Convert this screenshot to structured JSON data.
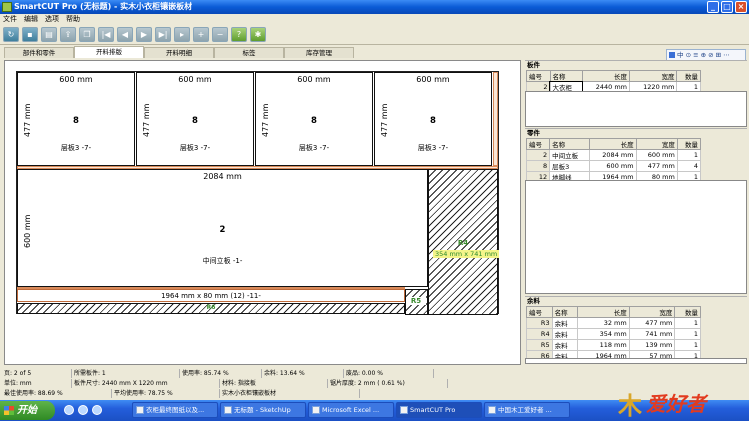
{
  "window": {
    "title": "SmartCUT Pro (无标题) - 实木小衣柜镶嵌板材",
    "controls": [
      "_",
      "□",
      "×"
    ]
  },
  "menu": [
    "文件",
    "编辑",
    "选项",
    "帮助"
  ],
  "toolbar": {
    "buttons": [
      "refresh-icon",
      "save-icon",
      "print-icon",
      "export-icon",
      "copy-icon",
      "first-icon",
      "prev-icon",
      "play-icon",
      "next-icon",
      "last-icon",
      "add-icon",
      "remove-icon",
      "help-icon",
      "settings-icon"
    ]
  },
  "tabs": [
    "部件和零件",
    "开料排版",
    "开料明细",
    "标签",
    "库存管理"
  ],
  "active_tab": "开料排版",
  "right_toolbar": {
    "label": "中 ⊙ ≡ ⊕ ⊘ ⊞ ⋯"
  },
  "layout": {
    "parts": [
      {
        "width": "600 mm",
        "height": "477 mm",
        "num": "8",
        "name": "层板3  -7-"
      },
      {
        "width": "600 mm",
        "height": "477 mm",
        "num": "8",
        "name": "层板3  -7-"
      },
      {
        "width": "600 mm",
        "height": "477 mm",
        "num": "8",
        "name": "层板3  -7-"
      },
      {
        "width": "600 mm",
        "height": "477 mm",
        "num": "8",
        "name": "层板3  -7-"
      }
    ],
    "big": {
      "width": "2084 mm",
      "height": "600 mm",
      "num": "2",
      "name": "中间立板  -1-"
    },
    "strip": {
      "label": "1964 mm x 80 mm (12)  -11-"
    },
    "r4": {
      "label": "R4",
      "dim": "354 mm x 741 mm"
    },
    "r5": {
      "label": "R5"
    },
    "r6": {
      "label": "R6"
    }
  },
  "panels": {
    "boards": {
      "caption": "板件",
      "headers": [
        "编号",
        "名称",
        "长度",
        "宽度",
        "数量"
      ],
      "rows": [
        [
          "2",
          "大衣柜",
          "2440 mm",
          "1220 mm",
          "1"
        ]
      ]
    },
    "parts": {
      "caption": "零件",
      "headers": [
        "编号",
        "名称",
        "长度",
        "宽度",
        "数量"
      ],
      "rows": [
        [
          "2",
          "中间立板",
          "2084 mm",
          "600 mm",
          "1"
        ],
        [
          "8",
          "层板3",
          "600 mm",
          "477 mm",
          "4"
        ],
        [
          "12",
          "地脚线",
          "1964 mm",
          "80 mm",
          "1"
        ]
      ]
    },
    "remnants": {
      "caption": "余料",
      "headers": [
        "编号",
        "名称",
        "长度",
        "宽度",
        "数量"
      ],
      "rows": [
        [
          "R3",
          "余料",
          "32 mm",
          "477 mm",
          "1"
        ],
        [
          "R4",
          "余料",
          "354 mm",
          "741 mm",
          "1"
        ],
        [
          "R5",
          "余料",
          "118 mm",
          "139 mm",
          "1"
        ],
        [
          "R6",
          "余料",
          "1964 mm",
          "57 mm",
          "1"
        ]
      ]
    }
  },
  "status": {
    "row1": [
      "页: 2 of 5",
      "所需板件: 1",
      "使用率: 85.74 %",
      "余料: 13.64 %",
      "废品: 0.00 %"
    ],
    "row2": [
      "单位: mm",
      "板件尺寸: 2440 mm X 1220 mm",
      "材料: 指接板",
      "锯片厚度: 2 mm  ( 0.61 %)"
    ],
    "row3": [
      "最佳使用率: 88.69 %",
      "平均使用率: 78.75 %",
      "实木小衣柜镶嵌板材"
    ]
  },
  "taskbar": {
    "start": "开始",
    "tasks": [
      "衣柜最终图纸以及...",
      "无标题 - SketchUp",
      "Microsoft Excel ...",
      "SmartCUT Pro",
      "中国木工爱好者 ..."
    ],
    "active": "SmartCUT Pro"
  },
  "logo": {
    "mark": "木",
    "text": "爱好者"
  }
}
